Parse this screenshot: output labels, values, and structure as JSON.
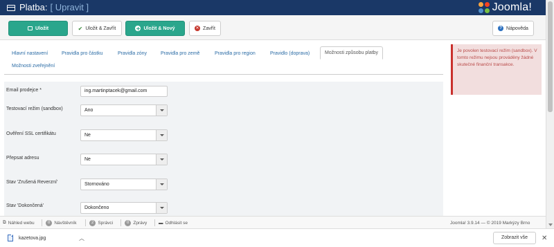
{
  "header": {
    "title": "Platba:",
    "subtitle": "[ Upravit ]",
    "logo_text": "Joomla!"
  },
  "toolbar": {
    "save_label": "Uložit",
    "save_close_label": "Uložit & Zavřít",
    "save_new_label": "Uložit & Nový",
    "close_label": "Zavřít",
    "help_label": "Nápověda"
  },
  "tabs": [
    {
      "label": "Hlavní nastavení"
    },
    {
      "label": "Pravidla pro částku"
    },
    {
      "label": "Pravidla zóny"
    },
    {
      "label": "Pravidla pro země"
    },
    {
      "label": "Pravidla pro region"
    },
    {
      "label": "Pravidlo (doprava)"
    },
    {
      "label": "Možnosti způsobu platby",
      "active": true
    },
    {
      "label": "Možnosti zveřejnění"
    }
  ],
  "form": {
    "email_label": "Email prodejce *",
    "email_value": "ing.martinptacek@gmail.com",
    "sandbox_label": "Testovací režim (sandbox)",
    "sandbox_value": "Ano",
    "ssl_label": "Ověření SSL certifikátu",
    "ssl_value": "Ne",
    "address_label": "Přepsat adresu",
    "address_value": "Ne",
    "reversed_label": "Stav 'Zrušená Reverzní'",
    "reversed_value": "Stornováno",
    "completed_label": "Stav 'Dokončená'",
    "completed_value": "Dokončeno"
  },
  "alert": {
    "text": "Je povolen testovací režim (sandbox). V tomto režimu nejsou prováděny žádné skutečné finanční transakce."
  },
  "status": {
    "preview_label": "Náhled webu",
    "visitors_count": "0",
    "visitors_label": "Návštěvník",
    "admins_count": "2",
    "admins_label": "Správci",
    "messages_count": "0",
    "messages_label": "Zprávy",
    "logout_label": "Odhlásit se",
    "version_text": "Joomla! 3.9.14 — © 2019 Markýzy Brno"
  },
  "downloads": {
    "filename": "kazetova.jpg",
    "show_all_label": "Zobrazit vše"
  },
  "colors": {
    "header_bg": "#1a3867",
    "green": "#2aa68c",
    "alert_bg": "#f2dede",
    "link": "#2a6ba5"
  }
}
